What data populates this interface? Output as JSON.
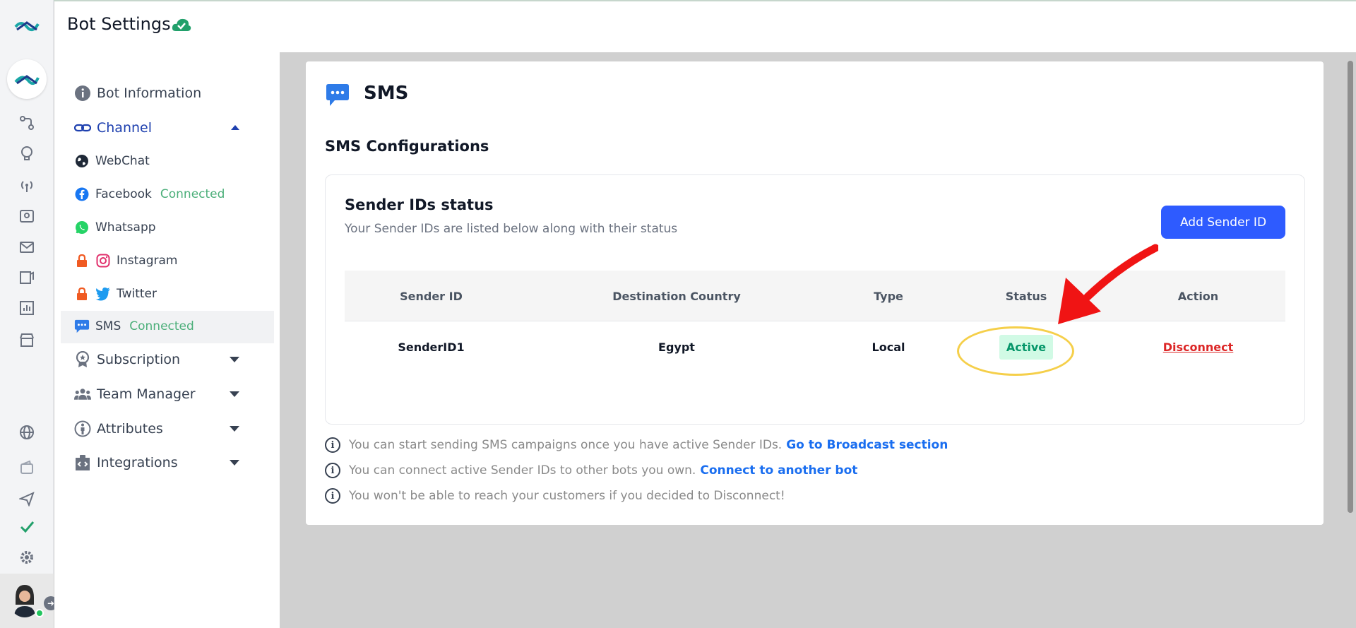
{
  "header": {
    "title": "Bot Settings"
  },
  "sidebar": {
    "items": [
      {
        "label": "Bot Information"
      },
      {
        "label": "Channel"
      },
      {
        "label": "Subscription"
      },
      {
        "label": "Team Manager"
      },
      {
        "label": "Attributes"
      },
      {
        "label": "Integrations"
      }
    ],
    "channels": [
      {
        "label": "WebChat",
        "status": ""
      },
      {
        "label": "Facebook",
        "status": "Connected"
      },
      {
        "label": "Whatsapp",
        "status": ""
      },
      {
        "label": "Instagram",
        "status": ""
      },
      {
        "label": "Twitter",
        "status": ""
      },
      {
        "label": "SMS",
        "status": "Connected"
      }
    ]
  },
  "main": {
    "channel_title": "SMS",
    "config_title": "SMS Configurations",
    "sender_status": {
      "title": "Sender IDs status",
      "subtitle": "Your Sender IDs are listed below along with their status",
      "add_button": "Add Sender ID"
    },
    "table": {
      "headers": [
        "Sender ID",
        "Destination Country",
        "Type",
        "Status",
        "Action"
      ],
      "rows": [
        {
          "sender_id": "SenderID1",
          "country": "Egypt",
          "type": "Local",
          "status": "Active",
          "action": "Disconnect"
        }
      ]
    },
    "notes": [
      {
        "text": "You can start sending SMS campaigns once you have active Sender IDs.",
        "link": "Go to Broadcast section"
      },
      {
        "text": "You can connect active Sender IDs to other bots you own.",
        "link": "Connect to another bot"
      },
      {
        "text": "You won't be able to reach your customers if you decided to Disconnect!",
        "link": ""
      }
    ]
  },
  "colors": {
    "primary": "#2e5bff",
    "connected": "#4caf7a",
    "active_badge": "#d1fae5",
    "disconnect": "#dc2626",
    "link": "#1a6ef0"
  }
}
